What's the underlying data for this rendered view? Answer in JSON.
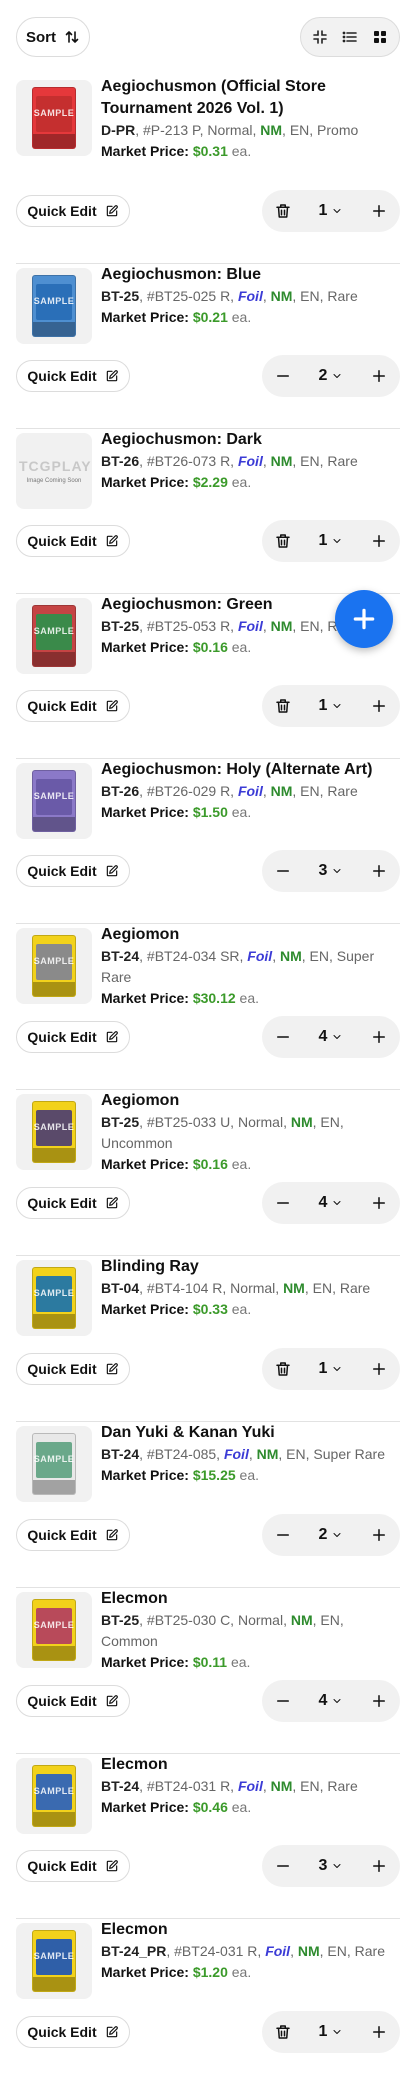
{
  "toolbar": {
    "sort_label": "Sort",
    "sort_icon": "sort-arrows-icon",
    "views": [
      "compact-view-icon",
      "list-view-icon",
      "grid-view-icon"
    ],
    "active_view": "grid"
  },
  "colors": {
    "accent": "#1a73f0",
    "price": "#3b9a2a",
    "foil": "#3b3bd6",
    "condition": "#2e8b2e"
  },
  "items": [
    {
      "name": "Aegiochusmon (Official Store Tournament 2026 Vol. 1)",
      "set": "D-PR",
      "rest": ", #P-213 P, Normal, ",
      "foil": "",
      "cond": "NM",
      "tail": ", EN, Promo",
      "price_label": "Market Price: ",
      "price": "$0.31",
      "ea": " ea.",
      "qty": "1",
      "left_action": "trash",
      "image": "card",
      "art": "#c52f2f",
      "body": "#e5383b"
    },
    {
      "name": "Aegiochusmon: Blue",
      "set": "BT-25",
      "rest": ", #BT25-025 R, ",
      "foil": "Foil",
      "cond": "NM",
      "tail": ", EN, Rare",
      "price_label": "Market Price: ",
      "price": "$0.21",
      "ea": " ea.",
      "qty": "2",
      "left_action": "minus",
      "image": "card",
      "art": "#2a6fb8",
      "body": "#4e8fd1"
    },
    {
      "name": "Aegiochusmon: Dark",
      "set": "BT-26",
      "rest": ", #BT26-073 R, ",
      "foil": "Foil",
      "cond": "NM",
      "tail": ", EN, Rare",
      "price_label": "Market Price: ",
      "price": "$2.29",
      "ea": " ea.",
      "qty": "1",
      "left_action": "trash",
      "image": "placeholder",
      "placeholder_logo": "TCGPLAYER",
      "placeholder_text": "Image Coming Soon"
    },
    {
      "name": "Aegiochusmon: Green",
      "set": "BT-25",
      "rest": ", #BT25-053 R, ",
      "foil": "Foil",
      "cond": "NM",
      "tail": ", EN, R",
      "price_label": "Market Price: ",
      "price": "$0.16",
      "ea": " ea.",
      "qty": "1",
      "left_action": "trash",
      "image": "card",
      "art": "#3a8a4a",
      "body": "#c54444"
    },
    {
      "name": "Aegiochusmon: Holy (Alternate Art)",
      "set": "BT-26",
      "rest": ", #BT26-029 R, ",
      "foil": "Foil",
      "cond": "NM",
      "tail": ", EN, Rare",
      "price_label": "Market Price: ",
      "price": "$1.50",
      "ea": " ea.",
      "qty": "3",
      "left_action": "minus",
      "image": "card",
      "art": "#6a5aa8",
      "body": "#8b79c8"
    },
    {
      "name": "Aegiomon",
      "set": "BT-24",
      "rest": ", #BT24-034 SR, ",
      "foil": "Foil",
      "cond": "NM",
      "tail": ", EN, Super Rare",
      "price_label": "Market Price: ",
      "price": "$30.12",
      "ea": " ea.",
      "qty": "4",
      "left_action": "minus",
      "image": "card",
      "art": "#8a8a8a",
      "body": "#f2d21b"
    },
    {
      "name": "Aegiomon",
      "set": "BT-25",
      "rest": ", #BT25-033 U, Normal, ",
      "foil": "",
      "cond": "NM",
      "tail": ", EN, Uncommon",
      "price_label": "Market Price: ",
      "price": "$0.16",
      "ea": " ea.",
      "qty": "4",
      "left_action": "minus",
      "image": "card",
      "art": "#5a4a6a",
      "body": "#f2d21b"
    },
    {
      "name": "Blinding Ray",
      "set": "BT-04",
      "rest": ", #BT4-104 R, Normal, ",
      "foil": "",
      "cond": "NM",
      "tail": ", EN, Rare",
      "price_label": "Market Price: ",
      "price": "$0.33",
      "ea": " ea.",
      "qty": "1",
      "left_action": "trash",
      "image": "card",
      "art": "#2c7aa0",
      "body": "#f2d21b"
    },
    {
      "name": "Dan Yuki & Kanan Yuki",
      "set": "BT-24",
      "rest": ", #BT24-085, ",
      "foil": "Foil",
      "cond": "NM",
      "tail": ", EN, Super Rare",
      "price_label": "Market Price: ",
      "price": "$15.25",
      "ea": " ea.",
      "qty": "2",
      "left_action": "minus",
      "image": "card",
      "art": "#6aa88a",
      "body": "#e8e8e8"
    },
    {
      "name": "Elecmon",
      "set": "BT-25",
      "rest": ", #BT25-030 C, Normal, ",
      "foil": "",
      "cond": "NM",
      "tail": ", EN, Common",
      "price_label": "Market Price: ",
      "price": "$0.11",
      "ea": " ea.",
      "qty": "4",
      "left_action": "minus",
      "image": "card",
      "art": "#b84a5a",
      "body": "#f2d21b"
    },
    {
      "name": "Elecmon",
      "set": "BT-24",
      "rest": ", #BT24-031 R, ",
      "foil": "Foil",
      "cond": "NM",
      "tail": ", EN, Rare",
      "price_label": "Market Price: ",
      "price": "$0.46",
      "ea": " ea.",
      "qty": "3",
      "left_action": "minus",
      "image": "card",
      "art": "#3a6ab0",
      "body": "#f2d21b"
    },
    {
      "name": "Elecmon",
      "set": "BT-24_PR",
      "rest": ", #BT24-031 R, ",
      "foil": "Foil",
      "cond": "NM",
      "tail": ", EN, Rare",
      "price_label": "Market Price: ",
      "price": "$1.20",
      "ea": " ea.",
      "qty": "1",
      "left_action": "trash",
      "image": "card",
      "art": "#2f5fa8",
      "body": "#f2d21b"
    }
  ],
  "quick_edit_label": "Quick Edit",
  "watermark": "SAMPLE",
  "fab_icon": "plus-icon"
}
